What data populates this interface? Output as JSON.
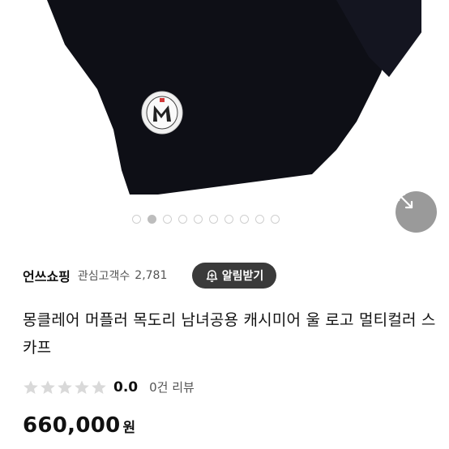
{
  "gallery": {
    "image_icon": "product-scarf-photo",
    "zoom_icon": "expand-arrows-icon",
    "dots_total": 10,
    "active_dot": 1
  },
  "seller": {
    "name": "언쓰쇼핑",
    "follower_label": "관심고객수",
    "follower_count": "2,781",
    "alarm_label": "알림받기",
    "alarm_icon": "bell-plus-icon"
  },
  "product": {
    "title": "몽클레어 머플러 목도리 남녀공용 캐시미어 울 로고 멀티컬러 스카프"
  },
  "rating": {
    "score": "0.0",
    "review_text": "0건 리뷰",
    "stars_filled": 0,
    "stars_total": 5
  },
  "price": {
    "value": "660,000",
    "unit": "원"
  },
  "colors": {
    "alarm_bg": "#3a3a3a",
    "star_empty": "#d9d9d9",
    "sale_red": "#e8413c"
  }
}
